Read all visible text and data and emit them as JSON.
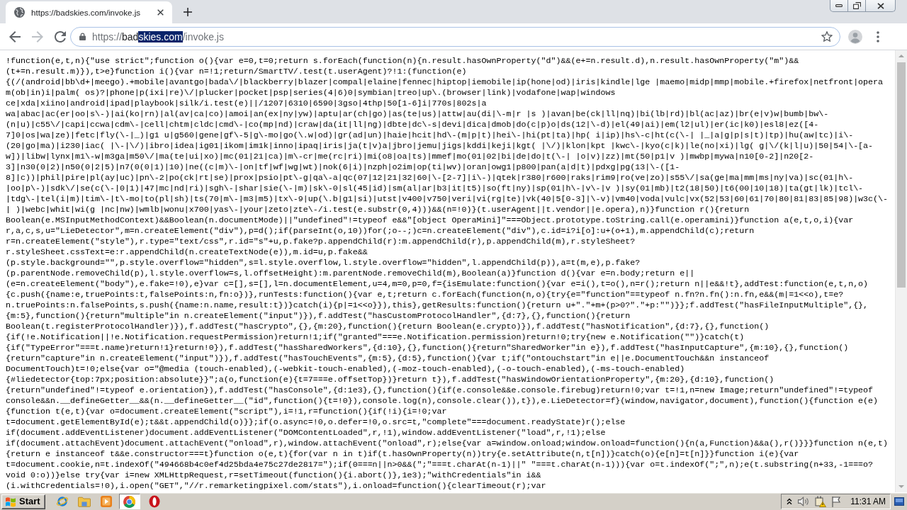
{
  "tabs": [
    {
      "title": "https://badskies.com/invoke.js",
      "selected": true
    }
  ],
  "nav_buttons": [
    {
      "kind": "back",
      "disabled": false
    },
    {
      "kind": "forward",
      "disabled": true
    },
    {
      "kind": "reload",
      "disabled": false
    }
  ],
  "address_bar": {
    "segments": [
      {
        "text": "https://",
        "kind": "scheme",
        "selected": false
      },
      {
        "text": "bad",
        "kind": "host",
        "selected": false
      },
      {
        "text": "skies.com",
        "kind": "host",
        "selected": true
      },
      {
        "text": "/invoke.js",
        "kind": "path",
        "selected": false
      }
    ]
  },
  "code_lines": [
    "!function(e,t,n){\"use strict\";function o(){var e=0,t=0;return s.forEach(function(n){n.result.hasOwnProperty(\"d\")&&(e+=n.result.d),n.result.hasOwnProperty(\"m\")&&",
    "(t+=n.result.m)}),t>e}function i(){var n=!1;return/SmartTV/.test(t.userAgent)?!1:(function(e)",
    "{(/(android|bb\\d+|meego).+mobile|avantgo|bada\\/|blackberry|blazer|compal|elaine|fennec|hiptop|iemobile|ip(hone|od)|iris|kindle|lge |maemo|midp|mmp|mobile.+firefox|netfront|opera",
    "m(ob|in)i|palm( os)?|phone|p(ixi|re)\\/|plucker|pocket|psp|series(4|6)0|symbian|treo|up\\.(browser|link)|vodafone|wap|windows",
    "ce|xda|xiino|android|ipad|playbook|silk/i.test(e)||/1207|6310|6590|3gso|4thp|50[1-6]i|770s|802s|a",
    "wa|abac|ac(er|oo|s\\-)|ai(ko|rn)|al(av|ca|co)|amoi|an(ex|ny|yw)|aptu|ar(ch|go)|as(te|us)|attw|au(di|\\-m|r |s )|avan|be(ck|ll|nq)|bi(lb|rd)|bl(ac|az)|br(e|v)w|bumb|bw\\-",
    "(n|u)|c55\\/|capi|ccwa|cdm\\-|cell|chtm|cldc|cmd\\-|co(mp|nd)|craw|da(it|ll|ng)|dbte|dc\\-s|devi|dica|dmob|do(c|p)o|ds(12|\\-d)|el(49|ai)|em(l2|ul)|er(ic|k0)|esl8|ez([4-",
    "7]0|os|wa|ze)|fetc|fly(\\-|_)|g1 u|g560|gene|gf\\-5|g\\-mo|go(\\.w|od)|gr(ad|un)|haie|hcit|hd\\-(m|p|t)|hei\\-|hi(pt|ta)|hp( i|ip)|hs\\-c|ht(c(\\-| |_|a|g|p|s|t)|tp)|hu(aw|tc)|i\\-",
    "(20|go|ma)|i230|iac( |\\-|\\/)|ibro|idea|ig01|ikom|im1k|inno|ipaq|iris|ja(t|v)a|jbro|jemu|jigs|kddi|keji|kgt( |\\/)|klon|kpt |kwc\\-|kyo(c|k)|le(no|xi)|lg( g|\\/(k|l|u)|50|54|\\-[a-",
    "w])|libw|lynx|m1\\-w|m3ga|m50\\/|ma(te|ui|xo)|mc(01|21|ca)|m\\-cr|me(rc|ri)|mi(o8|oa|ts)|mmef|mo(01|02|bi|de|do|t(\\-| |o|v)|zz)|mt(50|p1|v )|mwbp|mywa|n10[0-2]|n20[2-",
    "3]|n30(0|2)|n50(0|2|5)|n7(0(0|1)|10)|ne((c|m)\\-|on|tf|wf|wg|wt)|nok(6|i)|nzph|o2im|op(ti|wv)|oran|owg1|p800|pan(a|d|t)|pdxg|pg(13|\\-([1-",
    "8]|c))|phil|pire|pl(ay|uc)|pn\\-2|po(ck|rt|se)|prox|psio|pt\\-g|qa\\-a|qc(07|12|21|32|60|\\-[2-7]|i\\-)|qtek|r380|r600|raks|rim9|ro(ve|zo)|s55\\/|sa(ge|ma|mm|ms|ny|va)|sc(01|h\\-",
    "|oo|p\\-)|sdk\\/|se(c(\\-|0|1)|47|mc|nd|ri)|sgh\\-|shar|sie(\\-|m)|sk\\-0|sl(45|id)|sm(al|ar|b3|it|t5)|so(ft|ny)|sp(01|h\\-|v\\-|v )|sy(01|mb)|t2(18|50)|t6(00|10|18)|ta(gt|lk)|tcl\\-",
    "|tdg\\-|tel(i|m)|tim\\-|t\\-mo|to(pl|sh)|ts(70|m\\-|m3|m5)|tx\\-9|up(\\.b|g1|si)|utst|v400|v750|veri|vi(rg|te)|vk(40|5[0-3]|\\-v)|vm40|voda|vulc|vx(52|53|60|61|70|80|81|83|85|98)|w3c(\\-",
    "| )|webc|whit|wi(g |nc|nw)|wmlb|wonu|x700|yas\\-|your|zeto|zte\\-/i.test(e.substr(0,4)))&&(n=!0)}(t.userAgent||t.vendor||e.opera),n)}function r(){return",
    "Boolean(e.MSInputMethodContext)&&Boolean(n.documentMode)||\"undefined\"!=typeof e&&\"[object OperaMini]\"===Object.prototype.toString.call(e.operamini)}function a(e,t,o,i){var",
    "r,a,c,s,u=\"LieDetector\",m=n.createElement(\"div\"),p=d();if(parseInt(o,10))for(;o--;)c=n.createElement(\"div\"),c.id=i?i[o]:u+(o+1),m.appendChild(c);return",
    "r=n.createElement(\"style\"),r.type=\"text/css\",r.id=\"s\"+u,p.fake?p.appendChild(r):m.appendChild(r),p.appendChild(m),r.styleSheet?",
    "r.styleSheet.cssText=e:r.appendChild(n.createTextNode(e)),m.id=u,p.fake&&",
    "(p.style.background=\"\",p.style.overflow=\"hidden\",s=l.style.overflow,l.style.overflow=\"hidden\",l.appendChild(p)),a=t(m,e),p.fake?",
    "(p.parentNode.removeChild(p),l.style.overflow=s,l.offsetHeight):m.parentNode.removeChild(m),Boolean(a)}function d(){var e=n.body;return e||",
    "(e=n.createElement(\"body\"),e.fake=!0),e}var c=[],s=[],l=n.documentElement,u=4,m=0,p=0,f={isEmulate:function(){var e=i(),t=o(),n=r();return n||e&&!t},addTest:function(e,t,n,o)",
    "{c.push({name:e,truePoints:t,falsePoints:n,fn:o})},runTests:function(){var e,t;return c.forEach(function(n,o){try{e=\"function\"==typeof n.fn?n.fn():n.fn,e&&(m|=1<<o),t=e?",
    "n.truePoints:n.falsePoints,s.push({name:n.name,result:t})}catch(i){p|=1<<o}}),this},getResults:function(){return u+\".\"+m+(p>0?\".\"+p:\"\")}};f.addTest(\"hasFileInputMultiple\",{},",
    "{m:5},function(){return\"multiple\"in n.createElement(\"input\")}),f.addTest(\"hasCustomProtocolHandler\",{d:7},{},function(){return",
    "Boolean(t.registerProtocolHandler)}),f.addTest(\"hasCrypto\",{},{m:20},function(){return Boolean(e.crypto)}),f.addTest(\"hasNotification\",{d:7},{},function()",
    "{if(!e.Notification||!e.Notification.requestPermission)return!1;if(\"granted\"===e.Notification.permission)return!0;try{new e.Notification(\"\")}catch(t)",
    "{if(\"TypeError\"===t.name)return!1}return!0}),f.addTest(\"hasSharedWorkers\",{d:10},{},function(){return\"SharedWorker\"in e}),f.addTest(\"hasInputCapture\",{m:10},{},function()",
    "{return\"capture\"in n.createElement(\"input\")}),f.addTest(\"hasTouchEvents\",{m:5},{d:5},function(){var t;if(\"ontouchstart\"in e||e.DocumentTouch&&n instanceof",
    "DocumentTouch)t=!0;else{var o=\"@media (touch-enabled),(-webkit-touch-enabled),(-moz-touch-enabled),(-o-touch-enabled),(-ms-touch-enabled)",
    "{#liedetector{top:7px;position:absolute}}\";a(o,function(e){t=7===e.offsetTop})}return t}),f.addTest(\"hasWindowOrientationProperty\",{m:20},{d:10},function()",
    "{return\"undefined\"!=typeof e.orientation}),f.addTest(\"hasConsole\",{d:1e3},{},function(){if(e.console&&e.console.firebug)return!0;var t=!1,n=new Image;return\"undefined\"!=typeof",
    "console&&n.__defineGetter__&&(n.__defineGetter__(\"id\",function(){t=!0}),console.log(n),console.clear()),t}),e.LieDetector=f}(window,navigator,document),function(){function e(e)",
    "{function t(e,t){var o=document.createElement(\"script\"),i=!1,r=function(){if(!i){i=!0;var",
    "t=document.getElementById(e);t&&t.appendChild(o)}};if(o.async=!0,o.defer=!0,o.src=t,\"complete\"===document.readyState)r();else",
    "if(document.addEventListener)document.addEventListener(\"DOMContentLoaded\",r,!1),window.addEventListener(\"load\",r,!1);else",
    "if(document.attachEvent)document.attachEvent(\"onload\",r),window.attachEvent(\"onload\",r);else{var a=window.onload;window.onload=function(){n(a,Function)&&a(),r()}}}function n(e,t)",
    "{return e instanceof t&&e.constructor===t}function o(e,t){for(var n in t)if(t.hasOwnProperty(n))try{e.setAttribute(n,t[n])}catch(o){e[n]=t[n]}}function i(e){var",
    "t=document.cookie,n=t.indexOf(\"494668b4c0ef4d25bda4e75c27de2817=\");if(0===n||n>0&&(\";\"===t.charAt(n-1)||\" \"===t.charAt(n-1))){var o=t.indexOf(\";\",n);e(t.substring(n+33,-1===o?",
    "void 0:o))}else try{var i=new XMLHttpRequest,r=setTimeout(function(){i.abort()},1e3);\"withCredentials\"in i&&",
    "(i.withCredentials=!0),i.open(\"GET\",\"//r.remarketingpixel.com/stats\"),i.onload=function(){clearTimeout(r);var"
  ],
  "taskbar": {
    "start_label": "Start",
    "clock": "11:31 AM"
  }
}
